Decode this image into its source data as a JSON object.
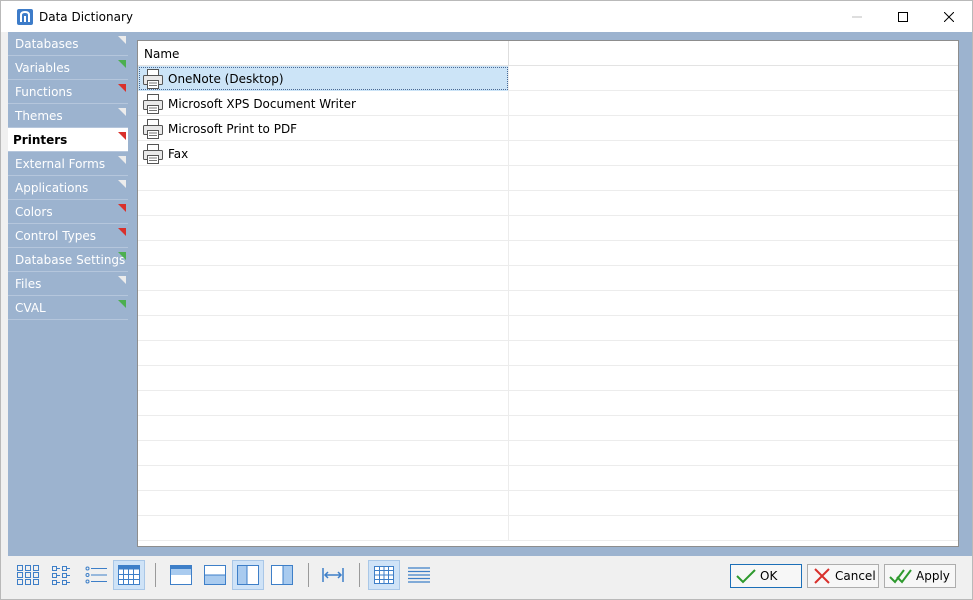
{
  "window": {
    "title": "Data Dictionary",
    "controls": [
      "minimize",
      "maximize",
      "close"
    ]
  },
  "sidebar": {
    "items": [
      {
        "label": "Databases",
        "marker": "white",
        "active": false
      },
      {
        "label": "Variables",
        "marker": "green",
        "active": false
      },
      {
        "label": "Functions",
        "marker": "red",
        "active": false
      },
      {
        "label": "Themes",
        "marker": "white",
        "active": false
      },
      {
        "label": "Printers",
        "marker": "red",
        "active": true
      },
      {
        "label": "External Forms",
        "marker": "white",
        "active": false
      },
      {
        "label": "Applications",
        "marker": "white",
        "active": false
      },
      {
        "label": "Colors",
        "marker": "red",
        "active": false
      },
      {
        "label": "Control Types",
        "marker": "red",
        "active": false
      },
      {
        "label": "Database Settings",
        "marker": "green",
        "active": false
      },
      {
        "label": "Files",
        "marker": "white",
        "active": false
      },
      {
        "label": "CVAL",
        "marker": "green",
        "active": false
      }
    ]
  },
  "grid": {
    "column_name": "Name",
    "rows": [
      {
        "name": "OneNote (Desktop)",
        "selected": true,
        "icon": "printer-icon"
      },
      {
        "name": "Microsoft XPS Document Writer",
        "selected": false,
        "icon": "printer-icon"
      },
      {
        "name": "Microsoft Print to PDF",
        "selected": false,
        "icon": "printer-icon"
      },
      {
        "name": "Fax",
        "selected": false,
        "icon": "printer-icon"
      }
    ],
    "empty_rows": 15
  },
  "toolbar": {
    "tools": [
      {
        "name": "large-icons-view-icon",
        "active": false
      },
      {
        "name": "small-icons-view-icon",
        "active": false
      },
      {
        "name": "list-view-icon",
        "active": false
      },
      {
        "name": "details-view-icon",
        "active": true
      },
      {
        "name": "panel-top-icon",
        "active": false
      },
      {
        "name": "panel-bottom-icon",
        "active": false
      },
      {
        "name": "panel-left-icon",
        "active": true
      },
      {
        "name": "panel-right-icon",
        "active": false
      },
      {
        "name": "fit-width-icon",
        "active": false
      },
      {
        "name": "grid-lines-icon",
        "active": true
      },
      {
        "name": "row-lines-icon",
        "active": false
      }
    ]
  },
  "buttons": {
    "ok": "OK",
    "cancel": "Cancel",
    "apply": "Apply"
  },
  "colors": {
    "sidebar_bg": "#9cb3cf",
    "selection": "#cce4f7",
    "marker_green": "#4caf50",
    "marker_red": "#d9302b"
  }
}
